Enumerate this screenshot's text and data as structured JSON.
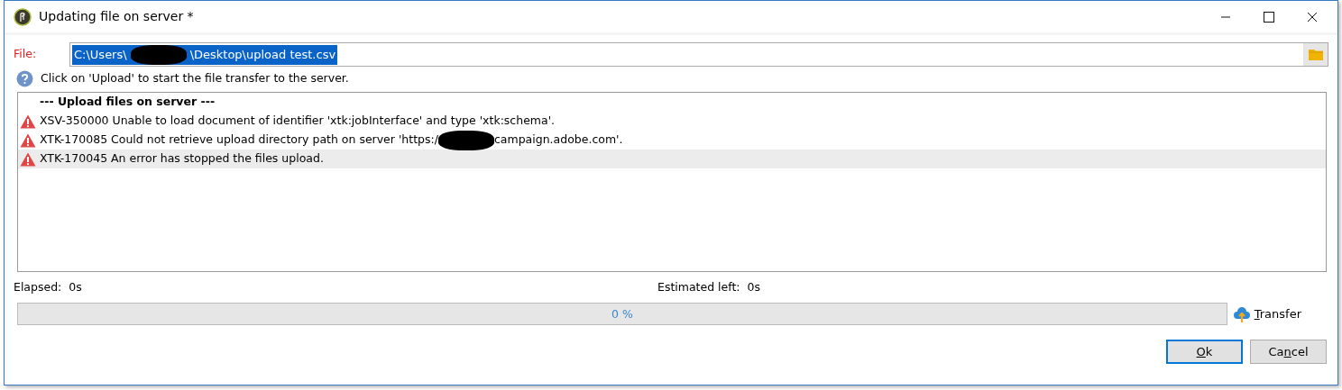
{
  "window": {
    "title": "Updating file on server *"
  },
  "file": {
    "label": "File:",
    "value_parts": [
      "C:\\Users\\",
      "\\Desktop\\upload test.csv"
    ],
    "selected": true
  },
  "info": "Click on 'Upload' to start the file transfer to the server.",
  "log": [
    {
      "kind": "heading",
      "parts": [
        "--- Upload files on server ---"
      ],
      "selected": false
    },
    {
      "kind": "error",
      "parts": [
        "XSV-350000 Unable to load document of identifier 'xtk:jobInterface' and type 'xtk:schema'."
      ],
      "selected": false
    },
    {
      "kind": "error",
      "parts": [
        "XTK-170085 Could not retrieve upload directory path on server 'https:/",
        "campaign.adobe.com'."
      ],
      "selected": false
    },
    {
      "kind": "error",
      "parts": [
        "XTK-170045 An error has stopped the files upload."
      ],
      "selected": true
    }
  ],
  "elapsed": {
    "label": "Elapsed:",
    "value": "0s"
  },
  "estimated": {
    "label": "Estimated left:",
    "value": "0s"
  },
  "progress": {
    "level": 0,
    "text": "0 %"
  },
  "transfer": {
    "label_parts": [
      {
        "text": "T",
        "underlined": true
      },
      {
        "text": "ransfer",
        "underlined": false
      }
    ]
  },
  "buttons": [
    {
      "label_parts": [
        {
          "text": "O",
          "underlined": true
        },
        {
          "text": "k",
          "underlined": false
        }
      ],
      "default": true
    },
    {
      "label_parts": [
        {
          "text": "Ca",
          "underlined": false
        },
        {
          "text": "n",
          "underlined": true
        },
        {
          "text": "cel",
          "underlined": false
        }
      ],
      "default": false
    }
  ]
}
